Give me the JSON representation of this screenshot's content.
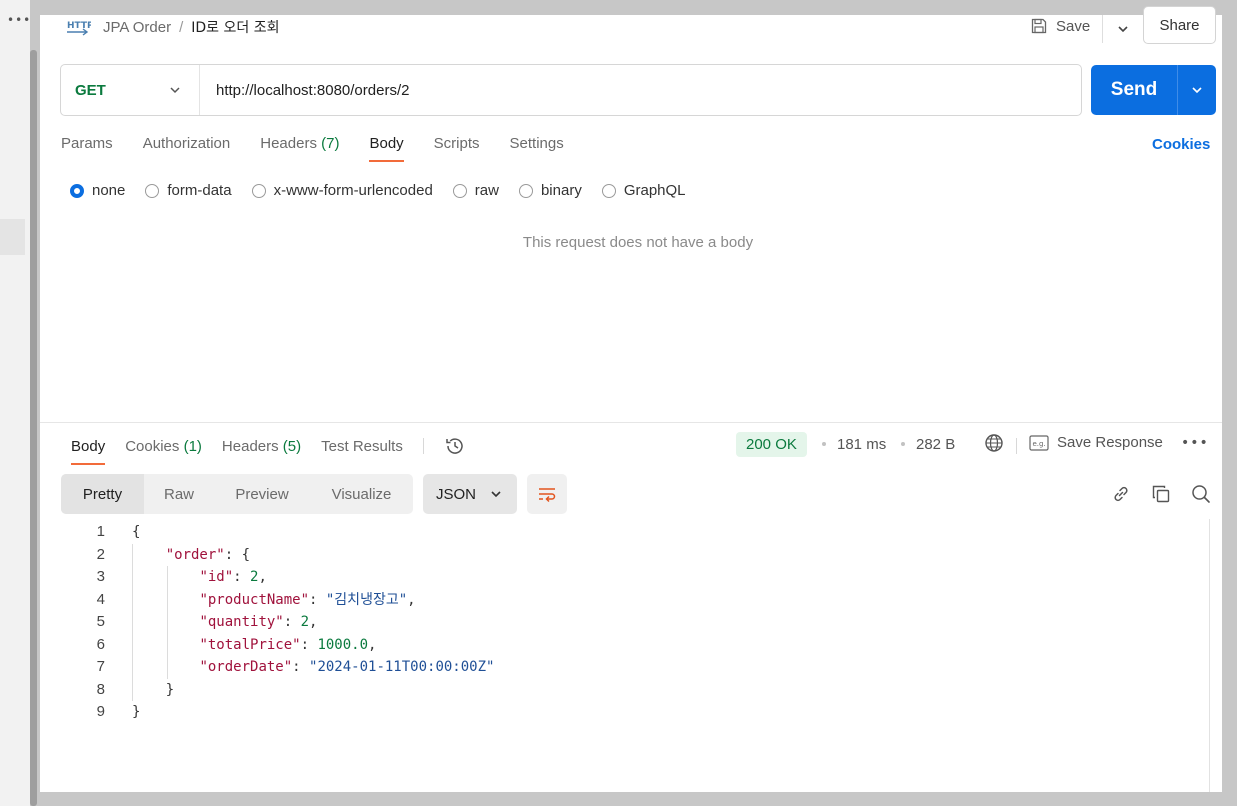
{
  "breadcrumb": {
    "parent": "JPA Order",
    "separator": "/",
    "current": "ID로 오더 조회"
  },
  "header": {
    "save_label": "Save",
    "share_label": "Share"
  },
  "request": {
    "method": "GET",
    "url": "http://localhost:8080/orders/2",
    "send_label": "Send"
  },
  "request_tabs": {
    "params": "Params",
    "authorization": "Authorization",
    "headers": "Headers",
    "headers_count": "(7)",
    "body": "Body",
    "scripts": "Scripts",
    "settings": "Settings",
    "active": "Body"
  },
  "cookies_link": "Cookies",
  "body_types": [
    "none",
    "form-data",
    "x-www-form-urlencoded",
    "raw",
    "binary",
    "GraphQL"
  ],
  "selected_body_type": "none",
  "no_body_message": "This request does not have a body",
  "response_tabs": {
    "body": "Body",
    "cookies": "Cookies",
    "cookies_count": "(1)",
    "headers": "Headers",
    "headers_count": "(5)",
    "test_results": "Test Results"
  },
  "response_meta": {
    "status": "200 OK",
    "time": "181 ms",
    "size": "282 B",
    "save_response": "Save Response"
  },
  "view_modes": [
    "Pretty",
    "Raw",
    "Preview",
    "Visualize"
  ],
  "format": "JSON",
  "response_body": {
    "lines": [
      [
        {
          "t": "p",
          "v": "{"
        }
      ],
      [
        {
          "t": "p",
          "v": "    "
        },
        {
          "t": "k",
          "v": "\"order\""
        },
        {
          "t": "p",
          "v": ": {"
        }
      ],
      [
        {
          "t": "p",
          "v": "        "
        },
        {
          "t": "k",
          "v": "\"id\""
        },
        {
          "t": "p",
          "v": ": "
        },
        {
          "t": "n",
          "v": "2"
        },
        {
          "t": "p",
          "v": ","
        }
      ],
      [
        {
          "t": "p",
          "v": "        "
        },
        {
          "t": "k",
          "v": "\"productName\""
        },
        {
          "t": "p",
          "v": ": "
        },
        {
          "t": "s",
          "v": "\"김치냉장고\""
        },
        {
          "t": "p",
          "v": ","
        }
      ],
      [
        {
          "t": "p",
          "v": "        "
        },
        {
          "t": "k",
          "v": "\"quantity\""
        },
        {
          "t": "p",
          "v": ": "
        },
        {
          "t": "n",
          "v": "2"
        },
        {
          "t": "p",
          "v": ","
        }
      ],
      [
        {
          "t": "p",
          "v": "        "
        },
        {
          "t": "k",
          "v": "\"totalPrice\""
        },
        {
          "t": "p",
          "v": ": "
        },
        {
          "t": "n",
          "v": "1000.0"
        },
        {
          "t": "p",
          "v": ","
        }
      ],
      [
        {
          "t": "p",
          "v": "        "
        },
        {
          "t": "k",
          "v": "\"orderDate\""
        },
        {
          "t": "p",
          "v": ": "
        },
        {
          "t": "s",
          "v": "\"2024-01-11T00:00:00Z\""
        }
      ],
      [
        {
          "t": "p",
          "v": "    }"
        }
      ],
      [
        {
          "t": "p",
          "v": "}"
        }
      ]
    ]
  },
  "colors": {
    "accent_orange": "#f26b3a",
    "send_blue": "#0b6ee0",
    "method_green": "#0b7a3e",
    "status_bg": "#e4f5ea",
    "json_key": "#a0123c",
    "json_number": "#0b7a3e",
    "json_string": "#1f4f96"
  },
  "icons": [
    "http-icon",
    "save-icon",
    "chevron-down-icon",
    "history-icon",
    "globe-icon",
    "example-icon",
    "more-icon",
    "wrap-icon",
    "link-icon",
    "copy-icon",
    "search-icon"
  ]
}
